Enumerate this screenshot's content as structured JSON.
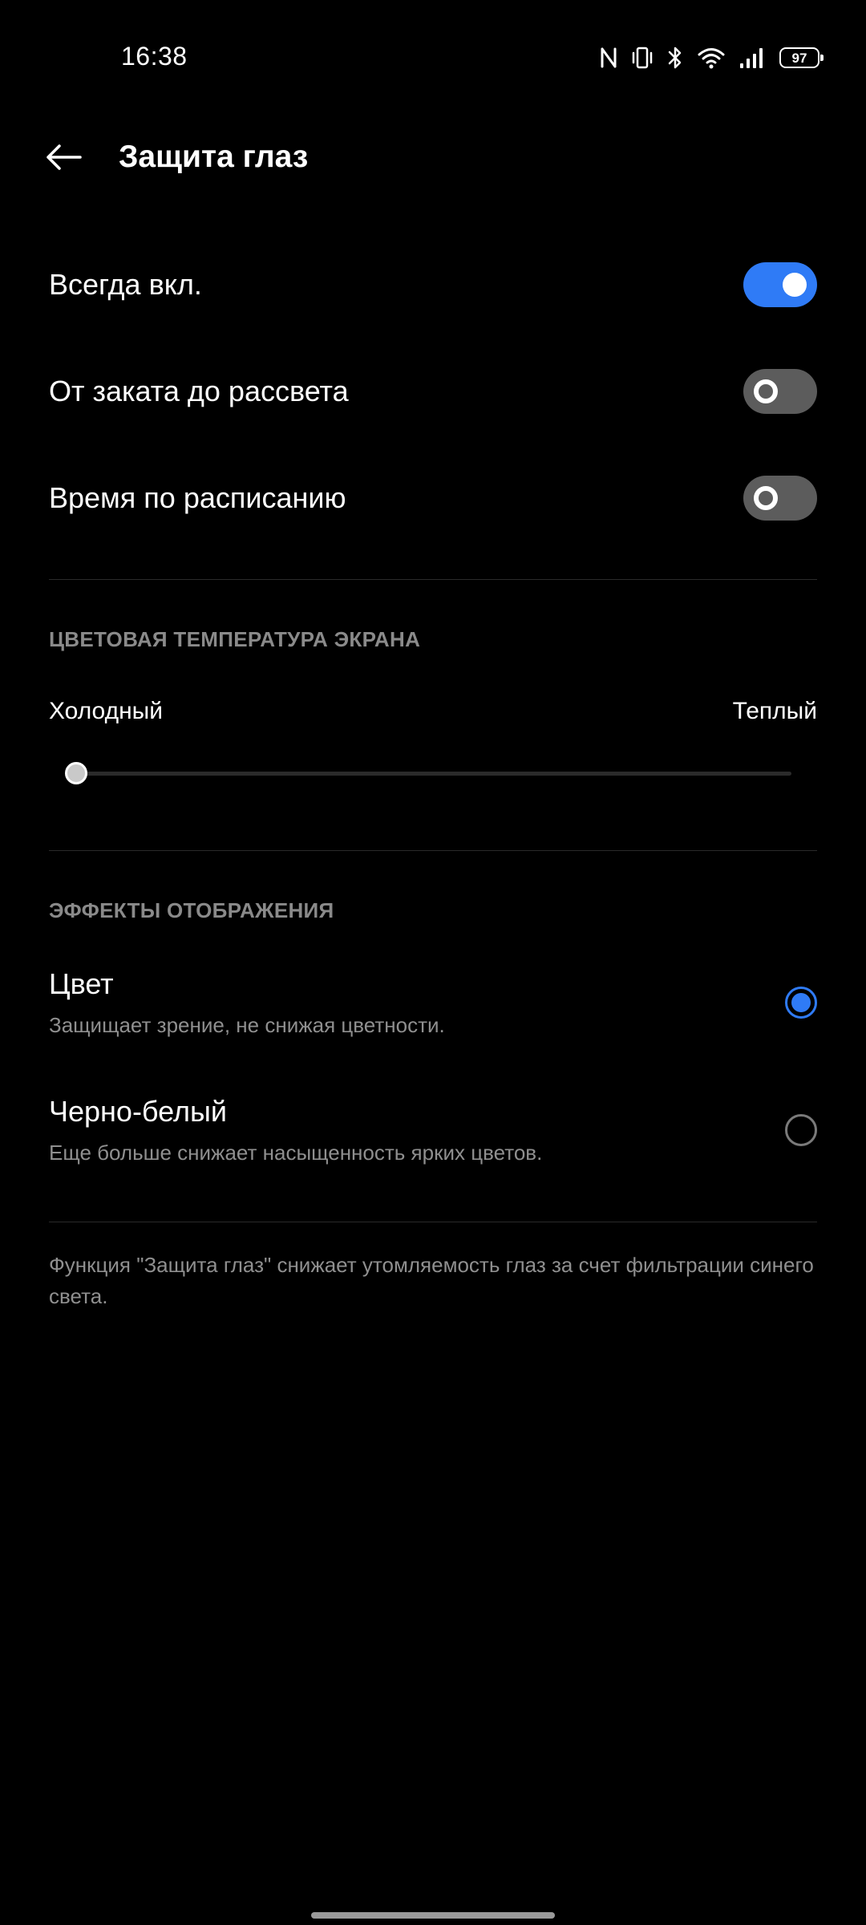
{
  "status_bar": {
    "time": "16:38",
    "battery": "97",
    "icons": [
      "nfc-icon",
      "vibrate-icon",
      "bluetooth-icon",
      "wifi-icon",
      "signal-icon",
      "battery-icon"
    ]
  },
  "header": {
    "back_icon": "arrow-left-icon",
    "title": "Защита глаз"
  },
  "schedule": {
    "items": [
      {
        "label": "Всегда вкл.",
        "on": true
      },
      {
        "label": "От заката до рассвета",
        "on": false
      },
      {
        "label": "Время по расписанию",
        "on": false
      }
    ]
  },
  "color_temperature": {
    "section_title": "ЦВЕТОВАЯ ТЕМПЕРАТУРА ЭКРАНА",
    "min_label": "Холодный",
    "max_label": "Теплый",
    "value": 0.0
  },
  "display_effects": {
    "section_title": "ЭФФЕКТЫ ОТОБРАЖЕНИЯ",
    "options": [
      {
        "title": "Цвет",
        "subtitle": "Защищает зрение, не снижая цветности.",
        "selected": true
      },
      {
        "title": "Черно-белый",
        "subtitle": "Еще больше снижает насыщенность ярких цветов.",
        "selected": false
      }
    ]
  },
  "footer_note": "Функция \"Защита глаз\" снижает утомляемость глаз за счет фильтрации синего света.",
  "colors": {
    "accent": "#2f7bf6",
    "background": "#000000",
    "switch_off": "#5c5c5c",
    "secondary_text": "#8f8f8f"
  }
}
